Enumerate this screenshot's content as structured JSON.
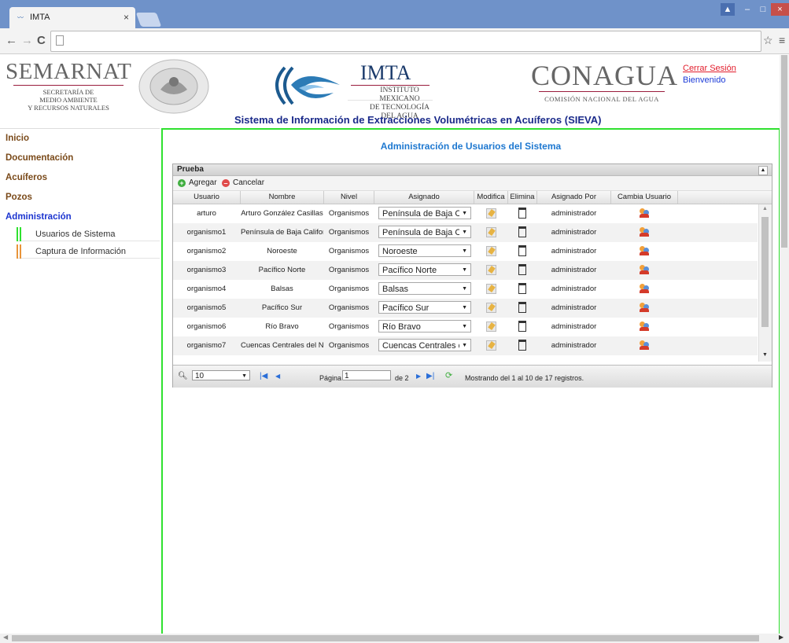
{
  "browser": {
    "tab_title": "IMTA",
    "tab_icon": "waves-icon",
    "win_user": "▲",
    "win_minimize": "–",
    "win_maximize": "□",
    "win_close": "×"
  },
  "header": {
    "semarnat": {
      "name": "SEMARNAT",
      "line1": "SECRETARÍA DE",
      "line2": "MEDIO AMBIENTE",
      "line3": "Y RECURSOS NATURALES"
    },
    "imta": {
      "name": "IMTA",
      "line1": "INSTITUTO MEXICANO",
      "line2": "DE TECNOLOGÍA",
      "line3": "DEL AGUA"
    },
    "conagua": {
      "name": "CONAGUA",
      "sub": "COMISIÓN NACIONAL DEL AGUA"
    },
    "logout": "Cerrar Sesión",
    "welcome": "Bienvenido",
    "system_title": "Sistema de Información de Extracciones Volumétricas en Acuíferos (SIEVA)"
  },
  "sidebar": {
    "items": [
      {
        "label": "Inicio"
      },
      {
        "label": "Documentación"
      },
      {
        "label": "Acuíferos"
      },
      {
        "label": "Pozos"
      },
      {
        "label": "Administración"
      }
    ],
    "subitems": [
      {
        "label": "Usuarios de Sistema",
        "color": "#2fe12f"
      },
      {
        "label": "Captura de Información",
        "color": "#e8943a"
      }
    ]
  },
  "main": {
    "title": "Administración de Usuarios del Sistema",
    "grid": {
      "caption": "Prueba",
      "add": "Agregar",
      "cancel": "Cancelar",
      "columns": [
        "Usuario",
        "Nombre",
        "Nivel",
        "Asignado",
        "Modifica",
        "Elimina",
        "Asignado Por",
        "Cambia Usuario"
      ],
      "rows": [
        {
          "usuario": "arturo",
          "nombre": "Arturo González Casillas",
          "nivel": "Organismos",
          "asignado": "Península de Baja California",
          "asignado_por": "administrador"
        },
        {
          "usuario": "organismo1",
          "nombre": "Península de Baja California",
          "nivel": "Organismos",
          "asignado": "Península de Baja California",
          "asignado_por": "administrador"
        },
        {
          "usuario": "organismo2",
          "nombre": "Noroeste",
          "nivel": "Organismos",
          "asignado": "Noroeste",
          "asignado_por": "administrador"
        },
        {
          "usuario": "organismo3",
          "nombre": "Pacífico Norte",
          "nivel": "Organismos",
          "asignado": "Pacífico Norte",
          "asignado_por": "administrador"
        },
        {
          "usuario": "organismo4",
          "nombre": "Balsas",
          "nivel": "Organismos",
          "asignado": "Balsas",
          "asignado_por": "administrador"
        },
        {
          "usuario": "organismo5",
          "nombre": "Pacífico Sur",
          "nivel": "Organismos",
          "asignado": "Pacífico Sur",
          "asignado_por": "administrador"
        },
        {
          "usuario": "organismo6",
          "nombre": "Río Bravo",
          "nivel": "Organismos",
          "asignado": "Río Bravo",
          "asignado_por": "administrador"
        },
        {
          "usuario": "organismo7",
          "nombre": "Cuencas Centrales del Norte",
          "nivel": "Organismos",
          "asignado": "Cuencas Centrales del Norte",
          "asignado_por": "administrador"
        }
      ],
      "pager": {
        "page_size": "10",
        "page_label": "Página",
        "page_value": "1",
        "of_label": "de 2",
        "records": "Mostrando del 1 al 10 de 17 registros."
      }
    }
  }
}
